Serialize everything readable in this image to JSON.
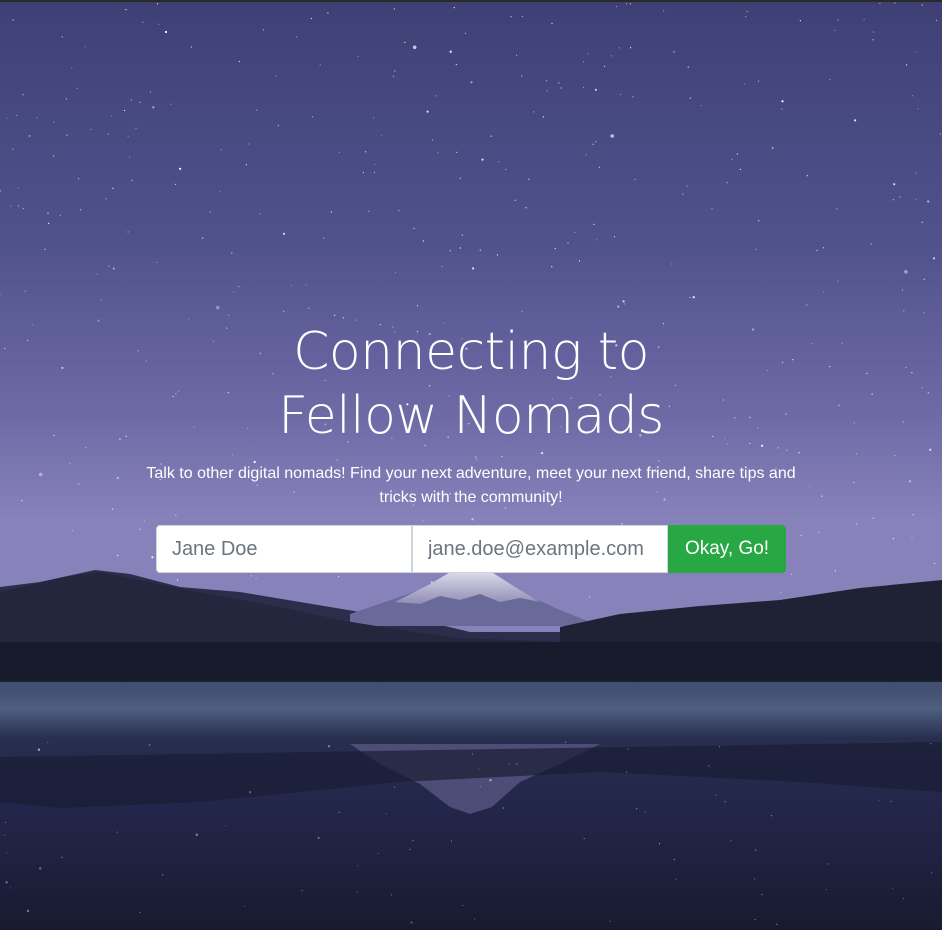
{
  "hero": {
    "title": "Connecting to Fellow Nomads",
    "subtitle": "Talk to other digital nomads! Find your next adventure, meet your next friend, share tips and tricks with the community!"
  },
  "signup_form": {
    "name_placeholder": "Jane Doe",
    "email_placeholder": "jane.doe@example.com",
    "submit_label": "Okay, Go!"
  },
  "colors": {
    "sky_top": "#4a4e86",
    "sky_horizon": "#7a76b0",
    "water": "#1c1f38",
    "button_green": "#28a745"
  },
  "icons": {
    "background": "night-sky-mountain-lake-image"
  }
}
